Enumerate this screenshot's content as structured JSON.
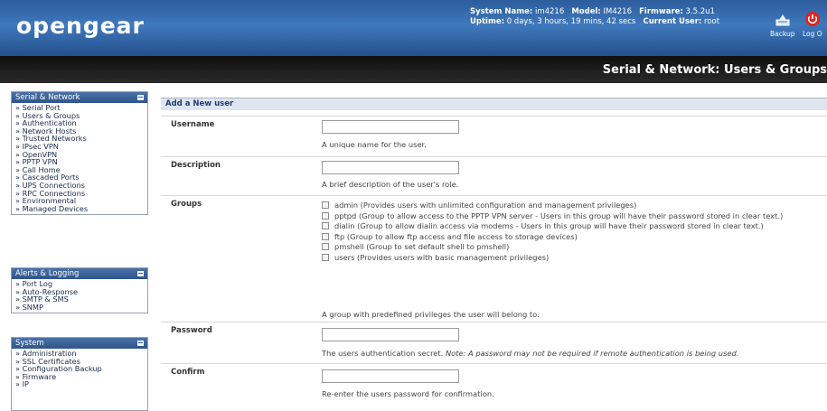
{
  "header": {
    "logo": "opengear",
    "system_name_label": "System Name:",
    "system_name": "im4216",
    "model_label": "Model:",
    "model": "IM4216",
    "firmware_label": "Firmware:",
    "firmware": "3.5.2u1",
    "uptime_label": "Uptime:",
    "uptime": "0 days, 3 hours, 19 mins, 42 secs",
    "user_label": "Current User:",
    "user": "root",
    "backup_label": "Backup",
    "logout_label": "Log O"
  },
  "page_title": "Serial & Network: Users & Groups",
  "sidebar": {
    "sections": [
      {
        "title": "Serial & Network",
        "items": [
          "» Serial Port",
          "» Users & Groups",
          "» Authentication",
          "» Network Hosts",
          "» Trusted Networks",
          "» IPsec VPN",
          "» OpenVPN",
          "» PPTP VPN",
          "» Call Home",
          "» Cascaded Ports",
          "» UPS Connections",
          "» RPC Connections",
          "» Environmental",
          "» Managed Devices"
        ]
      },
      {
        "title": "Alerts & Logging",
        "items": [
          "» Port Log",
          "» Auto-Response",
          "» SMTP & SMS",
          "» SNMP"
        ]
      },
      {
        "title": "System",
        "items": [
          "» Administration",
          "» SSL Certificates",
          "» Configuration Backup",
          "» Firmware",
          "» IP"
        ]
      }
    ]
  },
  "form": {
    "section_title": "Add a New user",
    "username": {
      "label": "Username",
      "value": "",
      "help": "A unique name for the user."
    },
    "description": {
      "label": "Description",
      "value": "",
      "help": "A brief description of the user's role."
    },
    "groups": {
      "label": "Groups",
      "options": [
        {
          "text": "admin (Provides users with unlimited configuration and management privileges)",
          "checked": false
        },
        {
          "text": "pptpd (Group to allow access to the PPTP VPN server - Users in this group will have their password stored in clear text.)",
          "checked": false
        },
        {
          "text": "dialin (Group to allow dialin access via modems - Users in this group will have their password stored in clear text.)",
          "checked": false
        },
        {
          "text": "ftp (Group to allow ftp access and file access to storage devices)",
          "checked": false
        },
        {
          "text": "pmshell (Group to set default shell to pmshell)",
          "checked": false
        },
        {
          "text": "users (Provides users with basic management privileges)",
          "checked": false
        }
      ],
      "help": "A group with predefined privileges the user will belong to."
    },
    "password": {
      "label": "Password",
      "value": "",
      "help": "The users authentication secret.",
      "note": "Note: A password may not be required if remote authentication is being used."
    },
    "confirm": {
      "label": "Confirm",
      "value": "",
      "help": "Re-enter the users password for confirmation."
    }
  },
  "colors": {
    "header_blue": "#3f78bd",
    "title_bar": "#1a1a1a",
    "section_bg": "#dfe5ef",
    "logout_red": "#e0231d"
  },
  "icons": {
    "backup": "backup-icon",
    "logout": "power-icon",
    "minimize": "minimize-icon"
  }
}
